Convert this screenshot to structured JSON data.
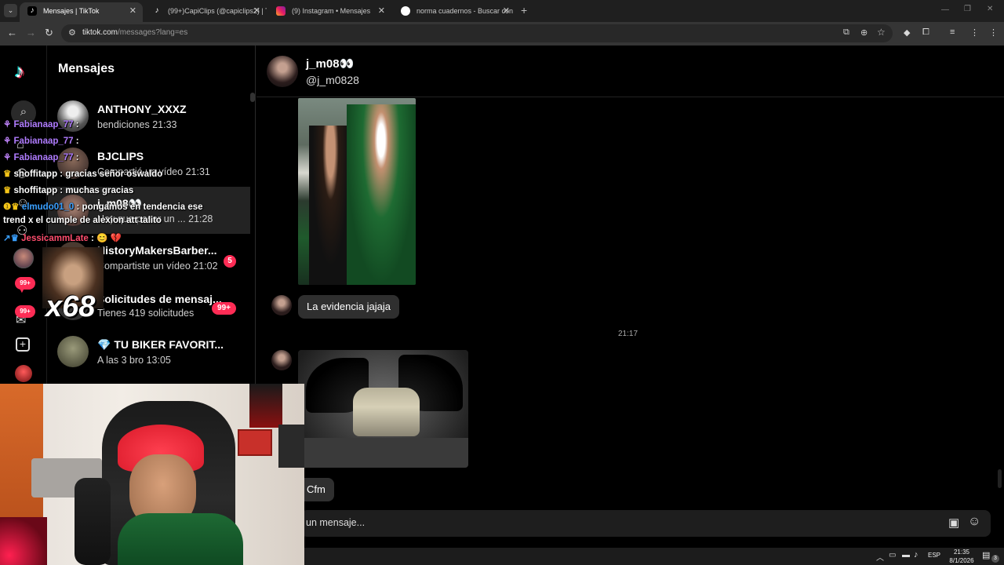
{
  "browser": {
    "tabs": [
      {
        "title": "Mensajes | TikTok",
        "active": true
      },
      {
        "title": "(99+)CapiClips (@capiclips2) | T",
        "active": false
      },
      {
        "title": "(9) Instagram • Mensajes",
        "active": false
      },
      {
        "title": "norma cuadernos - Buscar con",
        "active": false
      }
    ],
    "new_tab": "+",
    "url_host": "tiktok.com",
    "url_path": "/messages?lang=es"
  },
  "sidebar": {
    "title": "Mensajes"
  },
  "conversations": [
    {
      "name": "ANTHONY_XXXZ",
      "preview": "bendiciones",
      "time": "21:33"
    },
    {
      "name": "BJCLIPS",
      "preview": "Compartió un vídeo",
      "time": "21:31"
    },
    {
      "name": "j_m08👀",
      "preview": "Hay que pasar un ...",
      "time": "21:28"
    },
    {
      "name": "HistoryMakersBarber...",
      "preview": "Compartiste un vídeo",
      "time": "21:02",
      "badge": "5"
    },
    {
      "name": "Solicitudes de mensaj...",
      "preview": "Tienes 419 solicitudes",
      "badge": "99+"
    },
    {
      "name": "💎 TU BIKER FAVORIT...",
      "preview": "A las 3 bro",
      "time": "13:05"
    }
  ],
  "nav_badges": [
    "99+",
    "99+"
  ],
  "chat": {
    "name": "j_m08👀",
    "handle": "@j_m0828",
    "messages": {
      "text1": "La evidencia jajaja",
      "timestamp": "21:17",
      "text2": "Cfm"
    },
    "composer_placeholder": "un mensaje..."
  },
  "stream_chat": [
    {
      "user": "Fabianaap_77",
      "msg": ":"
    },
    {
      "user": "Fabianaap_77",
      "msg": ":"
    },
    {
      "user": "Fabianaap_77",
      "msg": ":"
    },
    {
      "user": "shoffitapp",
      "msg": ": gracias señor oswaldo"
    },
    {
      "user": "shoffitapp",
      "msg": ": muchas gracias"
    },
    {
      "user": "elmudo01_0",
      "msg": ": pongamos en tendencia ese"
    },
    {
      "user": "",
      "msg": "trend x el cumple de alexion att talito"
    },
    {
      "user": "JessicammLate",
      "msg": ": 😊 💔"
    }
  ],
  "overlay_counter": "x68",
  "taskbar": {
    "lang": "ESP",
    "time": "21:35",
    "date": "8/1/2026",
    "notif": "3"
  },
  "colors": {
    "accent": "#fe2c55",
    "username_purple": "#b07cff",
    "username_red": "#ff4d6d",
    "username_blue": "#3aa0ff"
  }
}
